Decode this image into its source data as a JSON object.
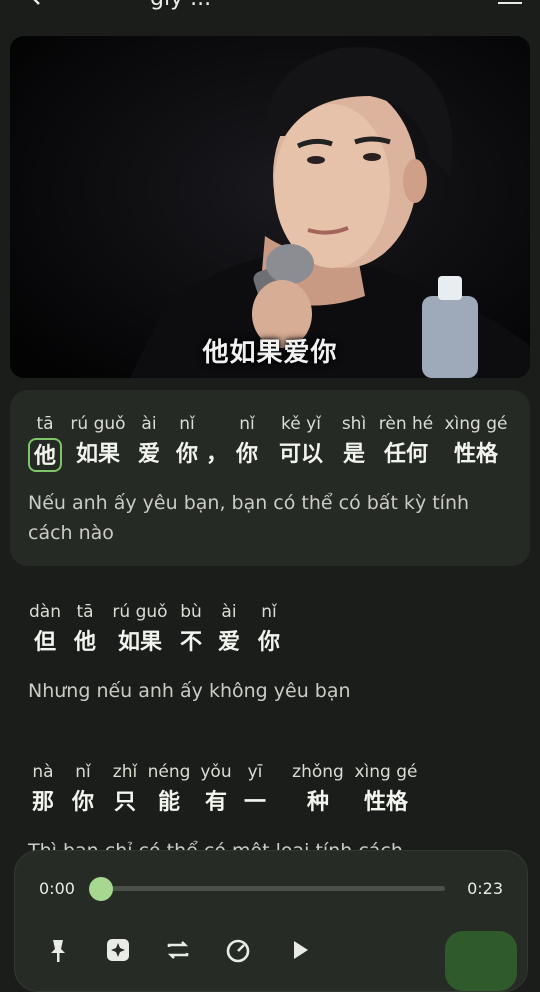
{
  "header": {
    "title_fragment": "gly ...",
    "back_icon": "chevron-left-icon",
    "menu_icon": "menu-icon"
  },
  "video": {
    "burned_subtitle": "他如果爱你"
  },
  "lines": [
    {
      "tokens": [
        {
          "py": "tā",
          "hz": "他"
        },
        {
          "py": "rú guǒ",
          "hz": "如果"
        },
        {
          "py": "ài",
          "hz": "爱"
        },
        {
          "py": "nǐ",
          "hz": "你"
        },
        {
          "py": "",
          "hz": "，"
        },
        {
          "py": "nǐ",
          "hz": "你"
        },
        {
          "py": "kě yǐ",
          "hz": "可以"
        },
        {
          "py": "shì",
          "hz": "是"
        },
        {
          "py": "rèn hé",
          "hz": "任何"
        },
        {
          "py": "xìng gé",
          "hz": "性格"
        }
      ],
      "translation": "Nếu anh ấy yêu bạn, bạn có thể có bất kỳ tính cách nào"
    },
    {
      "tokens": [
        {
          "py": "dàn",
          "hz": "但"
        },
        {
          "py": "tā",
          "hz": "他"
        },
        {
          "py": "rú guǒ",
          "hz": "如果"
        },
        {
          "py": "bù",
          "hz": "不"
        },
        {
          "py": "ài",
          "hz": "爱"
        },
        {
          "py": "nǐ",
          "hz": "你"
        }
      ],
      "translation": "Nhưng nếu anh ấy không yêu bạn"
    },
    {
      "tokens": [
        {
          "py": "nà",
          "hz": "那"
        },
        {
          "py": "nǐ",
          "hz": "你"
        },
        {
          "py": "zhǐ",
          "hz": "只"
        },
        {
          "py": "néng",
          "hz": "能"
        },
        {
          "py": "yǒu",
          "hz": "有"
        },
        {
          "py": "yī",
          "hz": "一"
        },
        {
          "py": "zhǒng",
          "hz": "种"
        },
        {
          "py": "xìng gé",
          "hz": "性格"
        }
      ],
      "translation": "Thì bạn chỉ có thể có một loại tính cách"
    }
  ],
  "player": {
    "current_time": "0:00",
    "duration": "0:23",
    "progress": 0,
    "controls": [
      "pin-icon",
      "sparkle-icon",
      "repeat-icon",
      "speed-icon",
      "play-icon"
    ],
    "accent_color": "#a6d98f"
  }
}
